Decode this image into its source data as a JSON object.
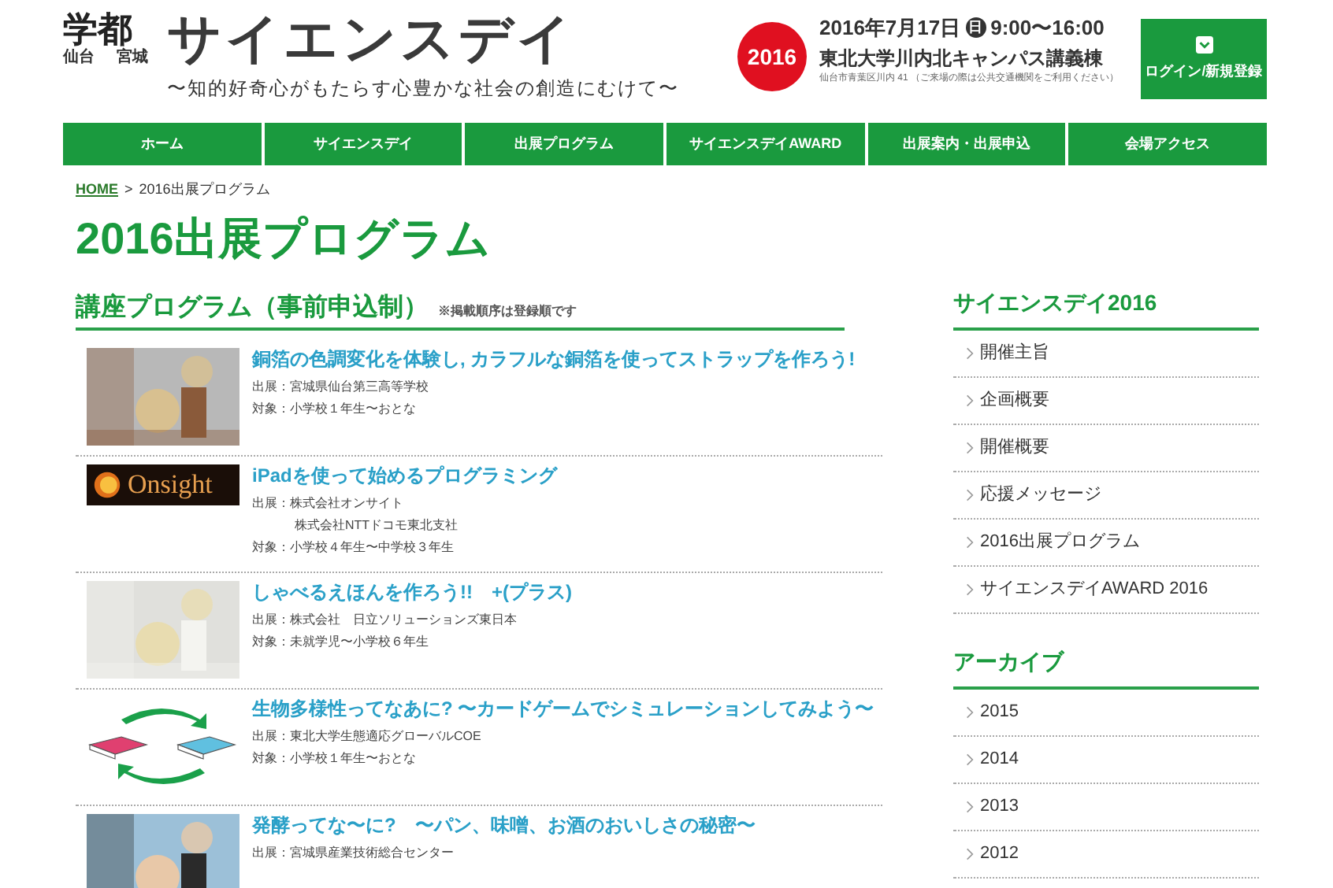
{
  "header": {
    "logo_top": "学都",
    "logo_left": "仙台",
    "logo_right": "宮城",
    "title": "サイエンスデイ",
    "tagline": "〜知的好奇心がもたらす心豊かな社会の創造にむけて〜",
    "year_badge": "2016",
    "date": "2016年7月17日",
    "weekday": "日",
    "time": "9:00〜16:00",
    "venue": "東北大学川内北キャンパス講義棟",
    "address": "仙台市青葉区川内 41 （ご来場の際は公共交通機関をご利用ください）",
    "login": "ログイン/新規登録"
  },
  "nav": [
    {
      "label": "ホーム"
    },
    {
      "label": "サイエンスデイ"
    },
    {
      "label": "出展プログラム"
    },
    {
      "label": "サイエンスデイAWARD"
    },
    {
      "label": "出展案内・出展申込"
    },
    {
      "label": "会場アクセス"
    }
  ],
  "breadcrumb": {
    "home": "HOME",
    "separator": ">",
    "current": "2016出展プログラム"
  },
  "page_title": "2016出展プログラム",
  "section": {
    "title": "講座プログラム（事前申込制）",
    "note": "※掲載順序は登録順です"
  },
  "programs": [
    {
      "title": "銅箔の色調変化を体験し, カラフルな銅箔を使ってストラップを作ろう!",
      "lines": [
        "出展：宮城県仙台第三高等学校",
        "対象：小学校１年生〜おとな"
      ]
    },
    {
      "kind": "logo",
      "logo_text": "Onsight",
      "title": "iPadを使って始めるプログラミング",
      "lines": [
        "出展：株式会社オンサイト",
        "株式会社NTTドコモ東北支社",
        "対象：小学校４年生〜中学校３年生"
      ]
    },
    {
      "title": "しゃべるえほんを作ろう!!　+(プラス)",
      "lines": [
        "出展：株式会社　日立ソリューションズ東日本",
        "対象：未就学児〜小学校６年生"
      ]
    },
    {
      "kind": "illustration",
      "title": "生物多様性ってなあに? 〜カードゲームでシミュレーションしてみよう〜",
      "lines": [
        "出展：東北大学生態適応グローバルCOE",
        "対象：小学校１年生〜おとな"
      ]
    },
    {
      "title": "発酵ってな〜に?　〜パン、味噌、お酒のおいしさの秘密〜",
      "lines": [
        "出展：宮城県産業技術総合センター"
      ]
    }
  ],
  "sidebar": [
    {
      "title": "サイエンスデイ2016",
      "items": [
        "開催主旨",
        "企画概要",
        "開催概要",
        "応援メッセージ",
        "2016出展プログラム",
        "サイエンスデイAWARD 2016"
      ]
    },
    {
      "title": "アーカイブ",
      "items": [
        "2015",
        "2014",
        "2013",
        "2012"
      ]
    }
  ]
}
